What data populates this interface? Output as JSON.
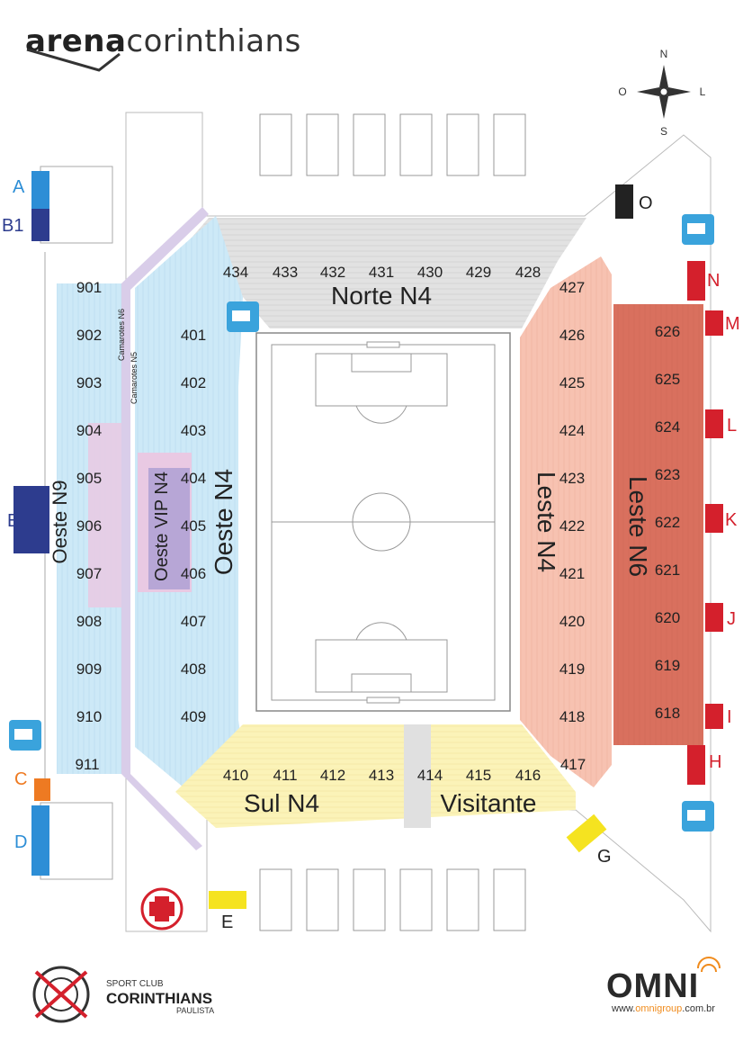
{
  "header": {
    "brand_bold": "arena",
    "brand_rest": "corinthians"
  },
  "compass": {
    "north": "N",
    "south": "S",
    "east": "L",
    "west": "O"
  },
  "sectors": {
    "norte": {
      "label": "Norte N4",
      "numbers": [
        "434",
        "433",
        "432",
        "431",
        "430",
        "429",
        "428"
      ]
    },
    "oeste": {
      "label": "Oeste N4",
      "numbers": [
        "401",
        "402",
        "403",
        "404",
        "405",
        "406",
        "407",
        "408",
        "409"
      ]
    },
    "oeste_vip": {
      "label": "Oeste VIP N4"
    },
    "oeste_n9": {
      "label": "Oeste N9",
      "numbers": [
        "901",
        "902",
        "903",
        "904",
        "905",
        "906",
        "907",
        "908",
        "909",
        "910",
        "911"
      ]
    },
    "camarotes": {
      "n6": "Camarotes N6",
      "n5": "Camarotes N5"
    },
    "leste_n4": {
      "label": "Leste N4",
      "numbers": [
        "427",
        "426",
        "425",
        "424",
        "423",
        "422",
        "421",
        "420",
        "419",
        "418",
        "417"
      ]
    },
    "leste_n6": {
      "label": "Leste N6",
      "numbers": [
        "626",
        "625",
        "624",
        "623",
        "622",
        "621",
        "620",
        "619",
        "618"
      ]
    },
    "sul": {
      "label": "Sul N4",
      "numbers": [
        "410",
        "411",
        "412",
        "413",
        "414"
      ]
    },
    "visitante": {
      "label": "Visitante",
      "numbers": [
        "415",
        "416"
      ]
    }
  },
  "gates": {
    "A": "A",
    "B1": "B1",
    "B": "B",
    "C": "C",
    "D": "D",
    "E": "E",
    "G": "G",
    "H": "H",
    "I": "I",
    "J": "J",
    "K": "K",
    "L": "L",
    "M": "M",
    "N": "N",
    "O": "O"
  },
  "footer": {
    "club_small": "SPORT CLUB",
    "club_name": "CORINTHIANS",
    "club_sub": "PAULISTA",
    "omni_logo": "OMNI",
    "omni_url_prefix": "www.",
    "omni_url_accent": "omnigroup",
    "omni_url_suffix": ".com.br"
  },
  "colors": {
    "oeste": "#cde9f7",
    "norte": "#e2e2e2",
    "leste_n4": "#f7c2b1",
    "leste_n6": "#d9705e",
    "sul": "#fbf3b8",
    "vip": "#b7a6d6",
    "pink": "#e9c9e3",
    "gate_blue": "#2d8ed6",
    "gate_dark": "#2d3c8e",
    "gate_red": "#d4202c",
    "gate_yellow": "#f5e320",
    "gate_orange": "#ee7a22",
    "ambulance": "#3aa3dc"
  }
}
